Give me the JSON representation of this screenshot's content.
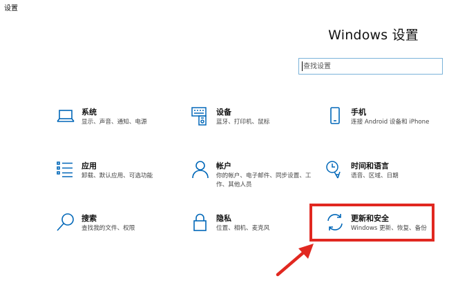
{
  "window": {
    "title": "设置"
  },
  "header": {
    "title": "Windows 设置"
  },
  "search": {
    "placeholder": "查找设置"
  },
  "categories": [
    {
      "name": "系统",
      "desc": "显示、声音、通知、电源",
      "icon": "laptop-icon"
    },
    {
      "name": "设备",
      "desc": "蓝牙、打印机、鼠标",
      "icon": "keyboard-printer-icon"
    },
    {
      "name": "手机",
      "desc": "连接 Android 设备和 iPhone",
      "icon": "phone-icon"
    },
    {
      "name": "应用",
      "desc": "卸载、默认应用、可选功能",
      "icon": "apps-list-icon"
    },
    {
      "name": "帐户",
      "desc": "你的帐户、电子邮件、同步设置、工作、其他人员",
      "icon": "person-icon"
    },
    {
      "name": "时间和语言",
      "desc": "语音、区域、日期",
      "icon": "time-language-icon"
    },
    {
      "name": "搜索",
      "desc": "查找我的文件、权限",
      "icon": "magnifier-icon"
    },
    {
      "name": "隐私",
      "desc": "位置、相机、麦克风",
      "icon": "lock-icon"
    },
    {
      "name": "更新和安全",
      "desc": "Windows 更新、恢复、备份",
      "icon": "sync-arrows-icon"
    }
  ],
  "colors": {
    "accent": "#0067b8",
    "highlight": "#e12820"
  }
}
